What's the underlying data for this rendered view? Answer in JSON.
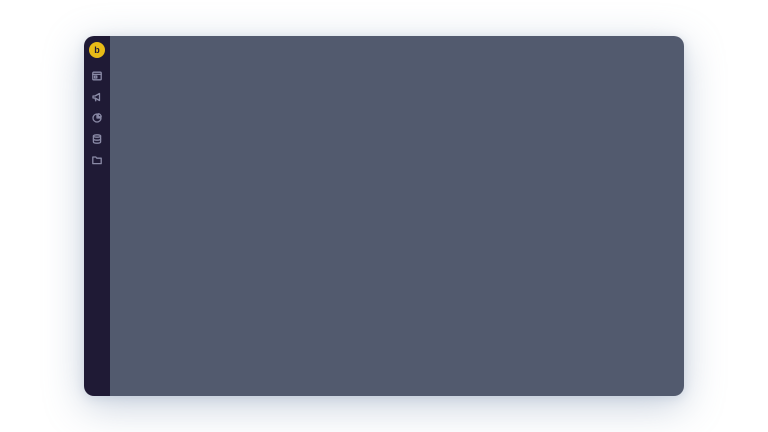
{
  "app": {
    "logo_letter": "b"
  },
  "sidebar": {
    "items": [
      {
        "icon": "dashboard-icon"
      },
      {
        "icon": "megaphone-icon"
      },
      {
        "icon": "pie-chart-icon"
      },
      {
        "icon": "database-icon"
      },
      {
        "icon": "folder-icon"
      }
    ]
  },
  "colors": {
    "sidebar_bg": "#1f1a35",
    "main_bg": "#525a6e",
    "accent": "#e8bb17",
    "icon": "#8a8aa6"
  }
}
